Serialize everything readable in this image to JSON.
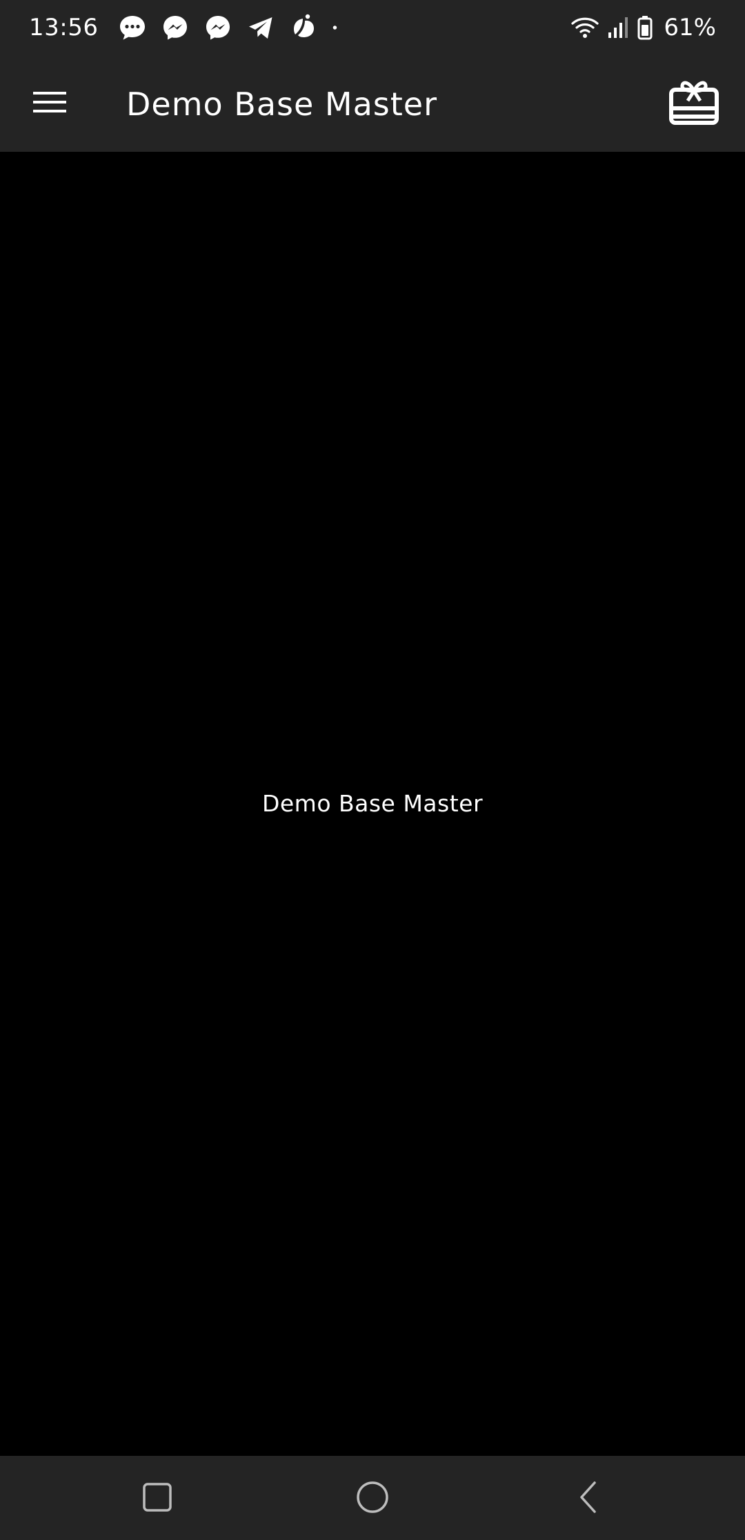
{
  "status_bar": {
    "time": "13:56",
    "notification_icons": [
      "message-icon",
      "messenger-icon",
      "messenger-icon",
      "telegram-icon",
      "leaf-app-icon",
      "more-dot-icon"
    ],
    "wifi": "wifi-icon",
    "signal": "signal-icon",
    "battery_icon": "battery-icon",
    "battery_percent": "61%"
  },
  "app_bar": {
    "menu_icon": "menu-icon",
    "title": "Demo Base Master",
    "action_icon": "gift-card-icon"
  },
  "content": {
    "center_text": "Demo Base Master"
  },
  "nav_bar": {
    "recents_icon": "recents-icon",
    "home_icon": "home-icon",
    "back_icon": "back-icon"
  },
  "colors": {
    "bars_background": "#242424",
    "content_background": "#000000",
    "text": "#ffffff"
  }
}
